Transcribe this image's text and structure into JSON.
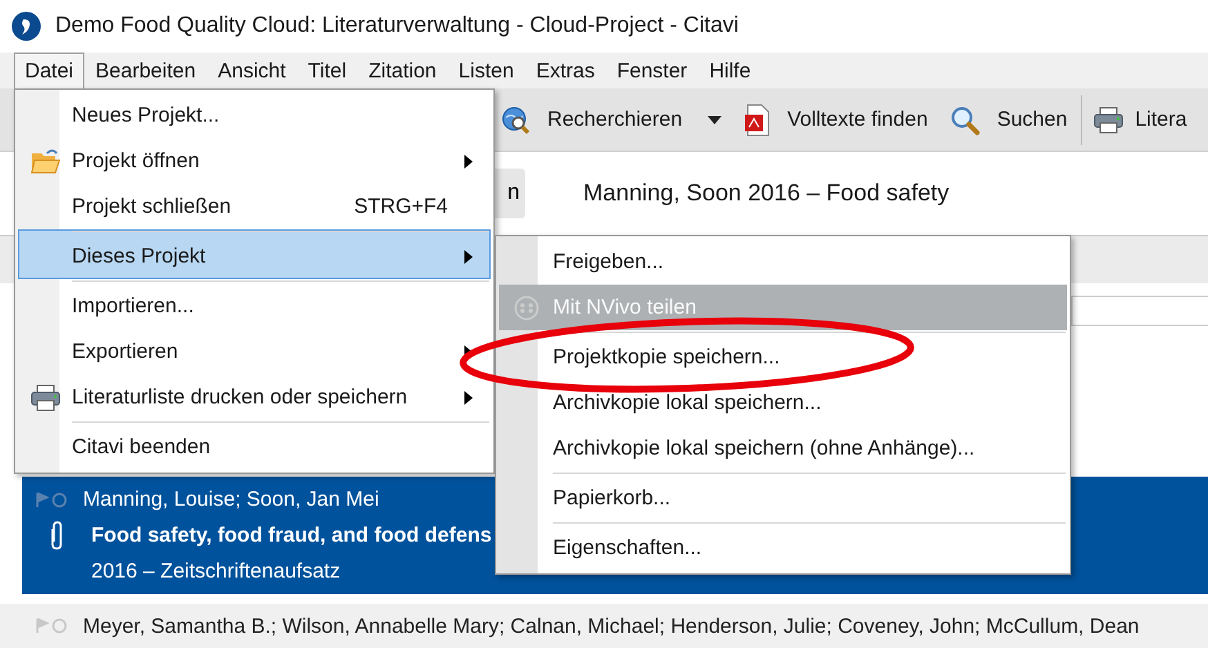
{
  "window": {
    "title": "Demo Food Quality Cloud: Literaturverwaltung - Cloud-Project - Citavi"
  },
  "menu_bar": [
    {
      "label": "Datei",
      "selected": true
    },
    {
      "label": "Bearbeiten",
      "selected": false
    },
    {
      "label": "Ansicht",
      "selected": false
    },
    {
      "label": "Titel",
      "selected": false
    },
    {
      "label": "Zitation",
      "selected": false
    },
    {
      "label": "Listen",
      "selected": false
    },
    {
      "label": "Extras",
      "selected": false
    },
    {
      "label": "Fenster",
      "selected": false
    },
    {
      "label": "Hilfe",
      "selected": false
    }
  ],
  "toolbar": [
    {
      "label": "Recherchieren",
      "kind": "globe",
      "dropdown": true,
      "separator_before": false
    },
    {
      "label": "Volltexte finden",
      "kind": "pdf",
      "dropdown": false,
      "separator_before": false
    },
    {
      "label": "Suchen",
      "kind": "search",
      "dropdown": false,
      "separator_before": false
    },
    {
      "label": "Litera",
      "kind": "printer",
      "dropdown": false,
      "separator_before": true
    }
  ],
  "header": {
    "button_label": "n",
    "title": "Manning, Soon 2016 – Food safety"
  },
  "references": [
    {
      "authors": "Manning, Louise; Soon, Jan Mei",
      "title": "Food safety, food fraud, and food defens",
      "meta": "2016 – Zeitschriftenaufsatz",
      "selected": true,
      "attachment": true
    },
    {
      "authors": "Meyer, Samantha B.; Wilson, Annabelle Mary; Calnan, Michael; Henderson, Julie; Coveney, John; McCullum, Dean",
      "selected": false
    }
  ],
  "file_menu": [
    {
      "label": "Neues Projekt...",
      "kind": "plain",
      "submenu": false,
      "highlighted": false,
      "separator_before": false
    },
    {
      "label": "Projekt öffnen",
      "kind": "folder",
      "submenu": true,
      "highlighted": false,
      "separator_before": false
    },
    {
      "label": "Projekt schließen",
      "shortcut": "STRG+F4",
      "kind": "plain",
      "submenu": false,
      "highlighted": false,
      "separator_before": false
    },
    {
      "label": "Dieses Projekt",
      "kind": "plain",
      "submenu": true,
      "highlighted": true,
      "separator_before": true
    },
    {
      "label": "Importieren...",
      "kind": "plain",
      "submenu": false,
      "highlighted": false,
      "separator_before": true
    },
    {
      "label": "Exportieren",
      "kind": "plain",
      "submenu": true,
      "highlighted": false,
      "separator_before": false
    },
    {
      "label": "Literaturliste drucken oder speichern",
      "kind": "printer",
      "submenu": true,
      "highlighted": false,
      "separator_before": false
    },
    {
      "label": "Citavi beenden",
      "kind": "plain",
      "submenu": false,
      "highlighted": false,
      "separator_before": true
    }
  ],
  "project_submenu": [
    {
      "label": "Freigeben...",
      "kind": "plain",
      "disabled": false,
      "highlighted": false,
      "separator_before": false
    },
    {
      "label": "Mit NVivo teilen",
      "kind": "nvivo",
      "disabled": true,
      "highlighted": true,
      "separator_before": false
    },
    {
      "label": "Projektkopie speichern...",
      "kind": "plain",
      "disabled": false,
      "highlighted": false,
      "separator_before": true
    },
    {
      "label": "Archivkopie lokal speichern...",
      "kind": "plain",
      "disabled": false,
      "highlighted": false,
      "separator_before": false
    },
    {
      "label": "Archivkopie lokal speichern (ohne Anhänge)...",
      "kind": "plain",
      "disabled": false,
      "highlighted": false,
      "separator_before": false
    },
    {
      "label": "Papierkorb...",
      "kind": "plain",
      "disabled": false,
      "highlighted": false,
      "separator_before": true
    },
    {
      "label": "Eigenschaften...",
      "kind": "plain",
      "disabled": false,
      "highlighted": false,
      "separator_before": true
    }
  ]
}
